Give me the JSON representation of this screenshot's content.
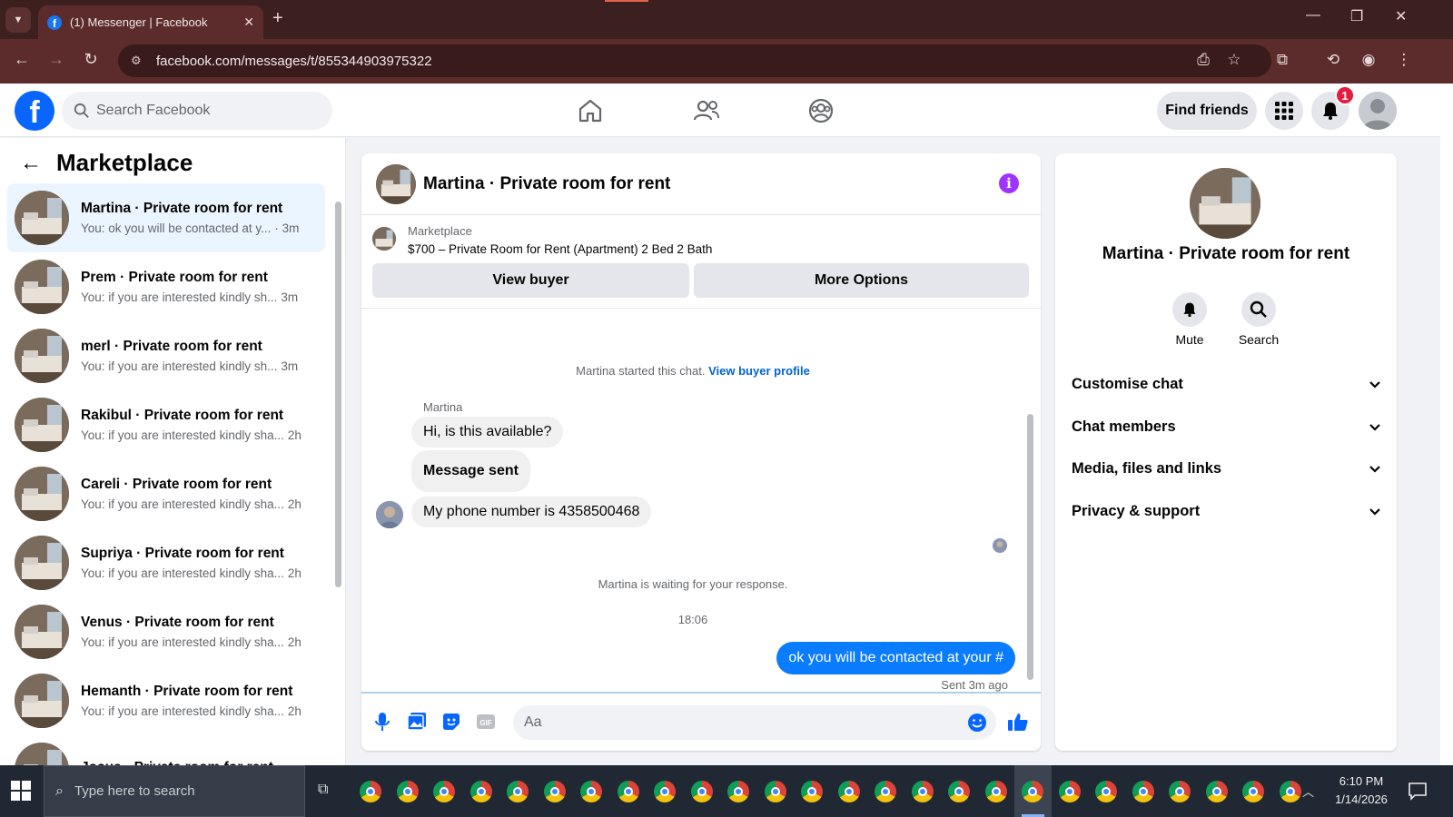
{
  "browser": {
    "tab_title": "(1) Messenger | Facebook",
    "url": "facebook.com/messages/t/855344903975322"
  },
  "fb": {
    "search_placeholder": "Search Facebook",
    "find_friends": "Find friends",
    "notification_count": "1",
    "accent_color": "#0866ff"
  },
  "left": {
    "title": "Marketplace",
    "conversations": [
      {
        "name": "Martina · Private room for rent",
        "preview": "You: ok you will be contacted at y...",
        "time": "· 3m",
        "active": true
      },
      {
        "name": "Prem · Private room for rent",
        "preview": "You: if you are interested kindly sh...",
        "time": "3m"
      },
      {
        "name": "merl · Private room for rent",
        "preview": "You: if you are interested kindly sh...",
        "time": "3m"
      },
      {
        "name": "Rakibul · Private room for rent",
        "preview": "You: if you are interested kindly sha...",
        "time": "2h"
      },
      {
        "name": "Careli · Private room for rent",
        "preview": "You: if you are interested kindly sha...",
        "time": "2h"
      },
      {
        "name": "Supriya · Private room for rent",
        "preview": "You: if you are interested kindly sha...",
        "time": "2h"
      },
      {
        "name": "Venus · Private room for rent",
        "preview": "You: if you are interested kindly sha...",
        "time": "2h"
      },
      {
        "name": "Hemanth · Private room for rent",
        "preview": "You: if you are interested kindly sha...",
        "time": "2h"
      },
      {
        "name": "Josua · Private room for rent",
        "preview": "",
        "time": ""
      }
    ]
  },
  "chat": {
    "title": "Martina · Private room for rent",
    "marketplace_label": "Marketplace",
    "listing": "$700 – Private Room for Rent (Apartment) 2 Bed 2 Bath",
    "view_buyer": "View buyer",
    "more_options": "More Options",
    "started_text": "Martina started this chat.",
    "view_buyer_profile": "View buyer profile",
    "sender": "Martina",
    "msg1": "Hi, is this available?",
    "msg2": "Message sent",
    "msg3": "My phone number is 4358500468",
    "waiting": "Martina is waiting for your response.",
    "timestamp": "18:06",
    "out_msg": "ok you will be contacted at your #",
    "sent_status": "Sent 3m ago",
    "composer_placeholder": "Aa"
  },
  "right": {
    "name": "Martina · Private room for rent",
    "mute": "Mute",
    "search": "Search",
    "sections": [
      "Customise chat",
      "Chat members",
      "Media, files and links",
      "Privacy & support"
    ]
  },
  "taskbar": {
    "search_placeholder": "Type here to search",
    "time": "6:10 PM",
    "date": "1/14/2026"
  }
}
